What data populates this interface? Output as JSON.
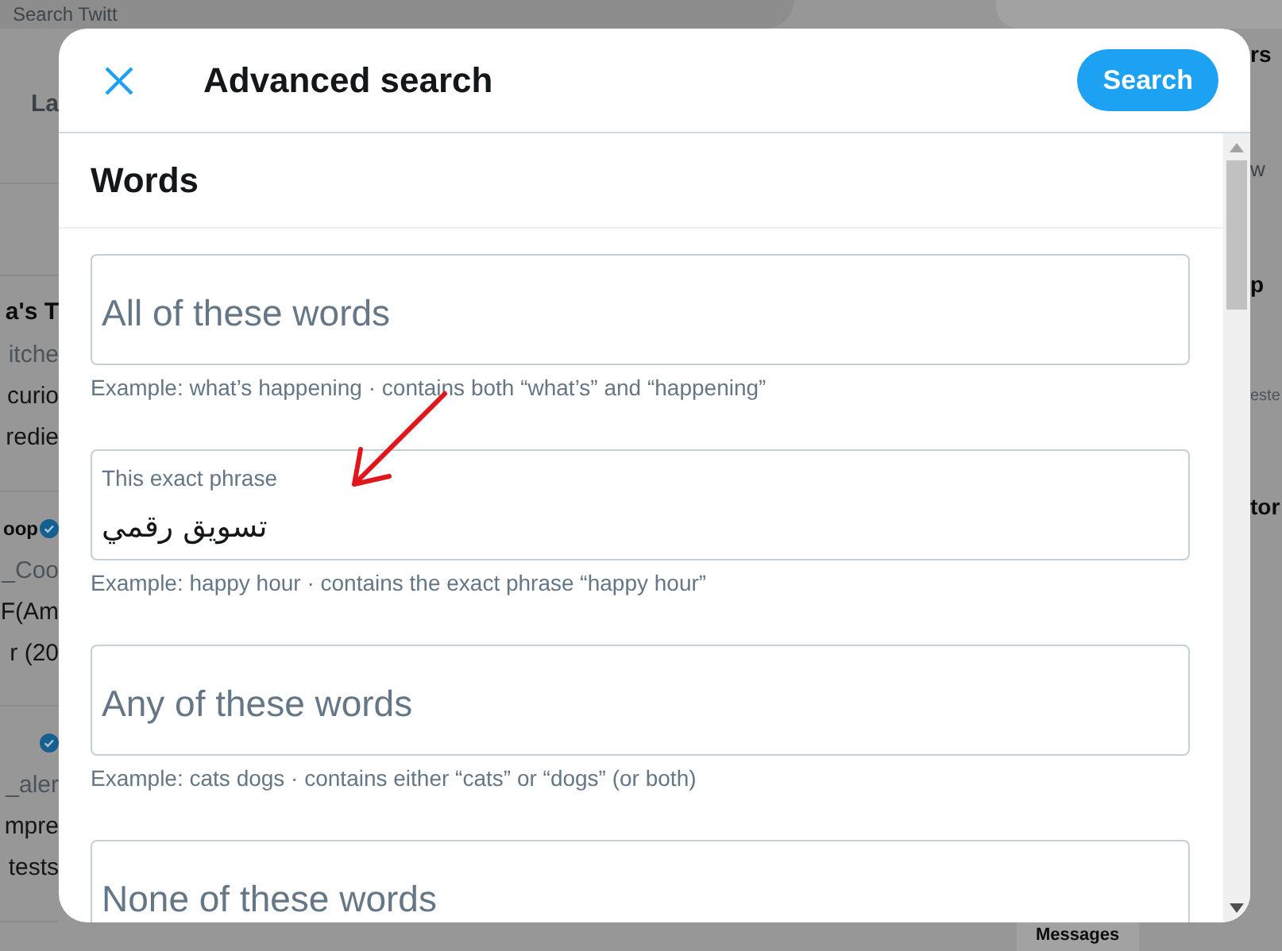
{
  "background": {
    "search_placeholder": "Search Twitt",
    "tab": "La",
    "left_rows": [
      {
        "kind": "blank",
        "lines": []
      },
      {
        "kind": "tweet",
        "verified": false,
        "author": "a's T",
        "lines": [
          "itche",
          "curio",
          "redie"
        ]
      },
      {
        "kind": "tweet",
        "verified": true,
        "author": "oop",
        "lines": [
          "_Coo",
          "F(Am",
          "r (20"
        ]
      },
      {
        "kind": "tweet",
        "verified": true,
        "lines": [
          "_aler",
          "mpre",
          "tests"
        ]
      }
    ],
    "right_fragments": [
      {
        "kind": "heading",
        "text": "rs"
      },
      {
        "kind": "text",
        "text": "w"
      },
      {
        "kind": "heading",
        "text": "p"
      },
      {
        "kind": "muted",
        "text": "este"
      },
      {
        "kind": "heading",
        "text": "tor"
      }
    ],
    "bottom_heading": "Messages"
  },
  "dialog": {
    "title": "Advanced search",
    "search_button": "Search",
    "section": "Words",
    "fields": [
      {
        "kind": "empty",
        "placeholder": "All of these words",
        "hint": "Example: what’s happening · contains both “what’s” and “happening”"
      },
      {
        "kind": "filled",
        "label": "This exact phrase",
        "value": "تسويق رقمي",
        "hint": "Example: happy hour · contains the exact phrase “happy hour”"
      },
      {
        "kind": "empty",
        "placeholder": "Any of these words",
        "hint": "Example: cats dogs · contains either “cats” or “dogs” (or both)"
      },
      {
        "kind": "empty",
        "placeholder": "None of these words"
      }
    ]
  }
}
